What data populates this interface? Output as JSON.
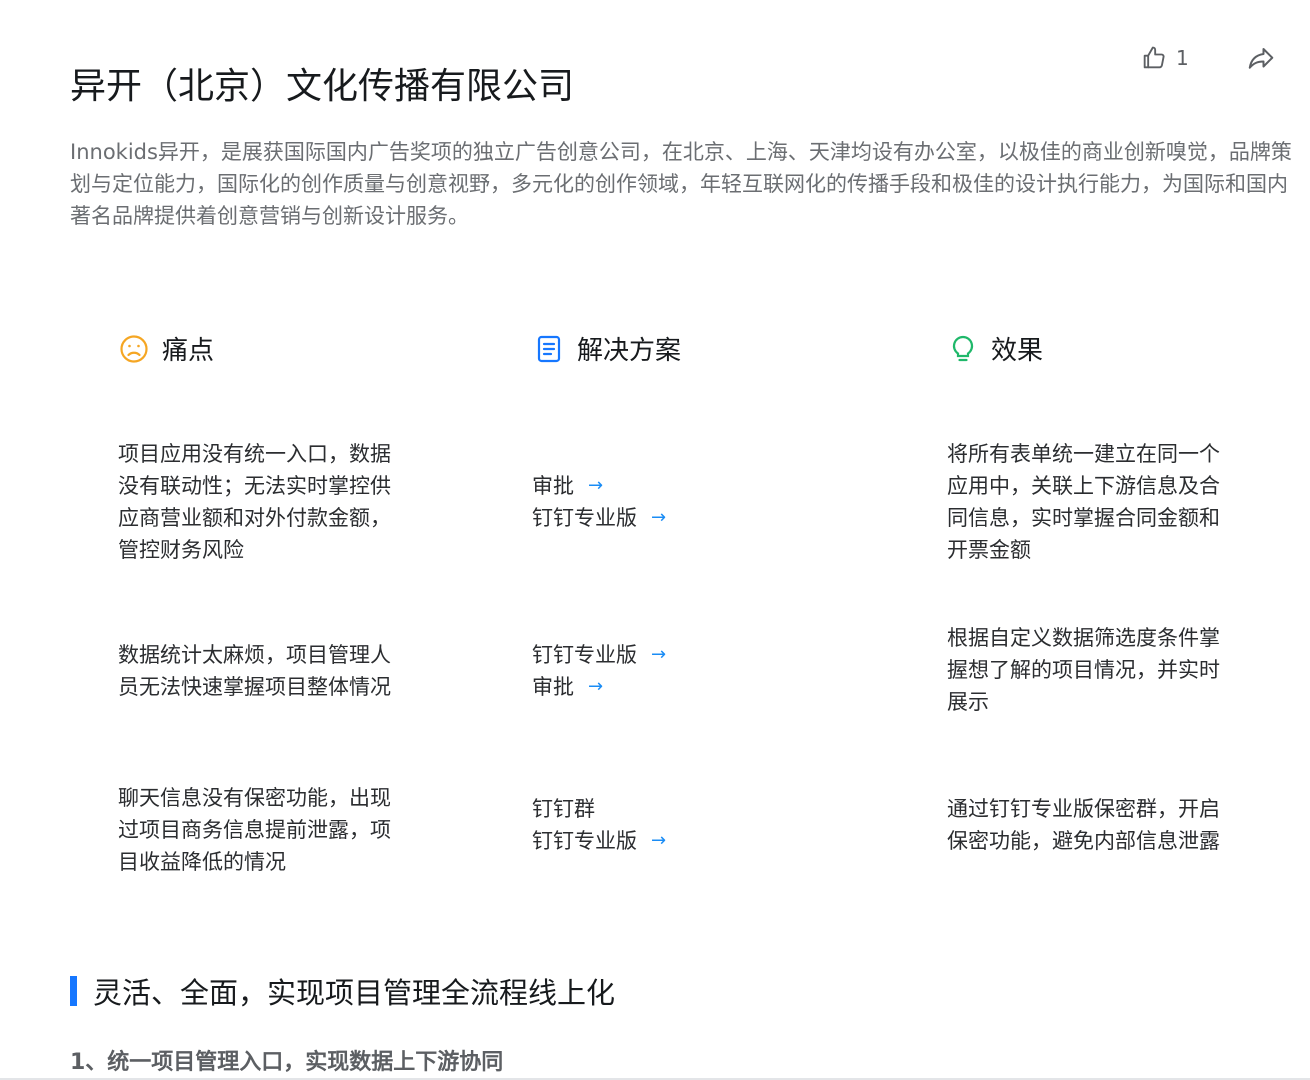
{
  "header": {
    "title": "异开（北京）文化传播有限公司",
    "like_count": "1",
    "like_icon": "thumbs-up-icon",
    "share_icon": "share-icon"
  },
  "description": "Innokids异开，是展获国际国内广告奖项的独立广告创意公司，在北京、上海、天津均设有办公室，以极佳的商业创新嗅觉，品牌策划与定位能力，国际化的创作质量与创意视野，多元化的创作领域，年轻互联网化的传播手段和极佳的设计执行能力，为国际和国内著名品牌提供着创意营销与创新设计服务。",
  "columns": {
    "pain": {
      "label": "痛点",
      "icon": "sad-face-icon",
      "color": "#f5a623"
    },
    "solution": {
      "label": "解决方案",
      "icon": "document-icon",
      "color": "#1677ff"
    },
    "effect": {
      "label": "效果",
      "icon": "lightbulb-icon",
      "color": "#1fb86a"
    }
  },
  "rows": [
    {
      "pain": "项目应用没有统一入口，数据没有联动性；无法实时掌控供应商营业额和对外付款金额，管控财务风险",
      "solutions": [
        {
          "label": "审批",
          "link": true
        },
        {
          "label": "钉钉专业版",
          "link": true
        }
      ],
      "effect": "将所有表单统一建立在同一个应用中，关联上下游信息及合同信息，实时掌握合同金额和开票金额"
    },
    {
      "pain": "数据统计太麻烦，项目管理人员无法快速掌握项目整体情况",
      "solutions": [
        {
          "label": "钉钉专业版",
          "link": true
        },
        {
          "label": "审批",
          "link": true
        }
      ],
      "effect": "根据自定义数据筛选度条件掌握想了解的项目情况，并实时展示"
    },
    {
      "pain": "聊天信息没有保密功能，出现过项目商务信息提前泄露，项目收益降低的情况",
      "solutions": [
        {
          "label": "钉钉群",
          "link": false
        },
        {
          "label": "钉钉专业版",
          "link": true
        }
      ],
      "effect": "通过钉钉专业版保密群，开启保密功能，避免内部信息泄露"
    }
  ],
  "arrow_glyph": "→",
  "section": {
    "title": "灵活、全面，实现项目管理全流程线上化",
    "subtitle": "1、统一项目管理入口，实现数据上下游协同"
  }
}
